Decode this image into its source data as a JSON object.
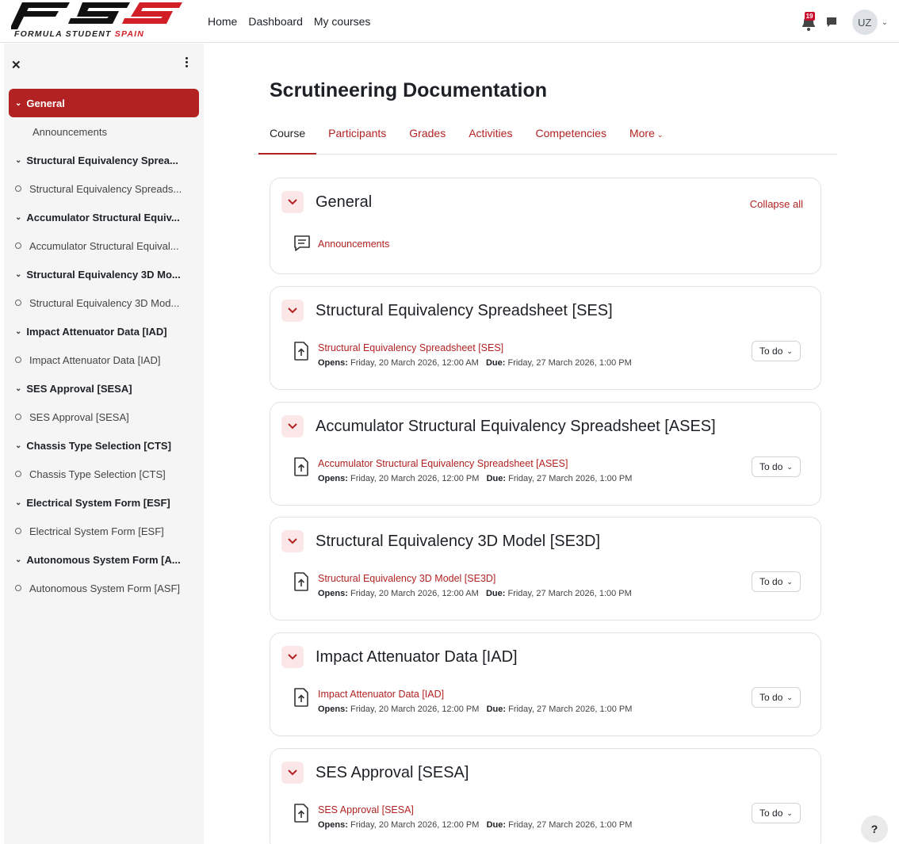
{
  "brand": {
    "logo_text": "FSS",
    "logo_subtitle_black": "FORMULA STUDENT",
    "logo_subtitle_red": "SPAIN",
    "logo_color": "#d21f26"
  },
  "nav": {
    "links": [
      "Home",
      "Dashboard",
      "My courses"
    ],
    "notification_count": "19",
    "user_initials": "UZ"
  },
  "drawer": {
    "close_icon": "close-icon",
    "menu_icon": "kebab-icon",
    "items": [
      {
        "label": "General",
        "kind": "section",
        "active": true
      },
      {
        "label": "Announcements",
        "kind": "sub"
      },
      {
        "label": "Structural Equivalency Sprea...",
        "kind": "section"
      },
      {
        "label": "Structural Equivalency Spreads...",
        "kind": "activity"
      },
      {
        "label": "Accumulator Structural Equiv...",
        "kind": "section"
      },
      {
        "label": "Accumulator Structural Equival...",
        "kind": "activity"
      },
      {
        "label": "Structural Equivalency 3D Mo...",
        "kind": "section"
      },
      {
        "label": "Structural Equivalency 3D Mod...",
        "kind": "activity"
      },
      {
        "label": "Impact Attenuator Data [IAD]",
        "kind": "section"
      },
      {
        "label": "Impact Attenuator Data [IAD]",
        "kind": "activity"
      },
      {
        "label": "SES Approval [SESA]",
        "kind": "section"
      },
      {
        "label": "SES Approval [SESA]",
        "kind": "activity"
      },
      {
        "label": "Chassis Type Selection [CTS]",
        "kind": "section"
      },
      {
        "label": "Chassis Type Selection [CTS]",
        "kind": "activity"
      },
      {
        "label": "Electrical System Form [ESF]",
        "kind": "section"
      },
      {
        "label": "Electrical System Form [ESF]",
        "kind": "activity"
      },
      {
        "label": "Autonomous System Form [A...",
        "kind": "section"
      },
      {
        "label": "Autonomous System Form [ASF]",
        "kind": "activity"
      }
    ]
  },
  "course": {
    "title": "Scrutineering Documentation",
    "tabs": [
      "Course",
      "Participants",
      "Grades",
      "Activities",
      "Competencies",
      "More"
    ],
    "active_tab": "Course",
    "collapse_all": "Collapse all",
    "general": {
      "title": "General",
      "activity": "Announcements"
    },
    "opens_label": "Opens:",
    "due_label": "Due:",
    "todo_label": "To do",
    "sections": [
      {
        "title": "Structural Equivalency Spreadsheet [SES]",
        "activity": "Structural Equivalency Spreadsheet [SES]",
        "opens": "Friday, 20 March 2026, 12:00 AM",
        "due": "Friday, 27 March 2026, 1:00 PM"
      },
      {
        "title": "Accumulator Structural Equivalency Spreadsheet [ASES]",
        "activity": "Accumulator Structural Equivalency Spreadsheet [ASES]",
        "opens": "Friday, 20 March 2026, 12:00 PM",
        "due": "Friday, 27 March 2026, 1:00 PM"
      },
      {
        "title": "Structural Equivalency 3D Model [SE3D]",
        "activity": "Structural Equivalency 3D Model [SE3D]",
        "opens": "Friday, 20 March 2026, 12:00 AM",
        "due": "Friday, 27 March 2026, 1:00 PM"
      },
      {
        "title": "Impact Attenuator Data [IAD]",
        "activity": "Impact Attenuator Data [IAD]",
        "opens": "Friday, 20 March 2026, 12:00 PM",
        "due": "Friday, 27 March 2026, 1:00 PM"
      },
      {
        "title": "SES Approval [SESA]",
        "activity": "SES Approval [SESA]",
        "opens": "Friday, 20 March 2026, 12:00 PM",
        "due": "Friday, 27 March 2026, 1:00 PM"
      }
    ]
  },
  "help": {
    "label": "?"
  },
  "colors": {
    "accent": "#b22222",
    "accent_light": "#fbe7e7",
    "drawer_bg": "#f5f5f5"
  }
}
